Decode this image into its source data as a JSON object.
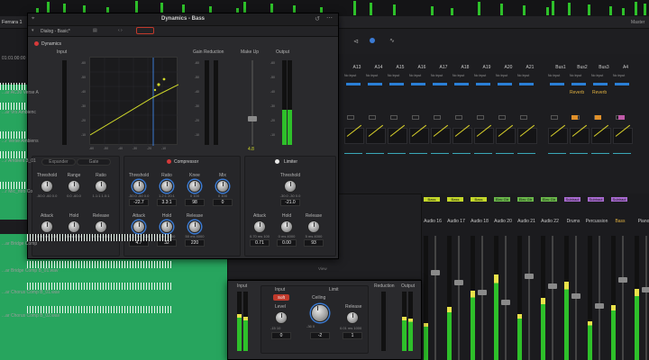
{
  "background": {
    "timeline_title": "Ferrara 1",
    "timecode": "01:01:00:00",
    "track_labels": [
      "...ar AC30 Verse A",
      "...ar Vrs Ambienc",
      "...r Verse Ambiens",
      "...r Ambient 3_01",
      "...r Mic_ntro Co",
      "...ar Bridge Comp",
      "...ar Bridge Comp B_01.wav",
      "...ar Chorus Comp B_01.wav",
      "...ar Chorus Comp B_02.wav"
    ],
    "channels_top": [
      "A13",
      "A14",
      "A15",
      "A16",
      "A17",
      "A18",
      "A19",
      "A20",
      "A21",
      "Bus1",
      "Bus2",
      "Bus3",
      "A4"
    ],
    "no_input": "No Input",
    "reverb": "Reverb",
    "chips": [
      "Bass",
      "Bass",
      "Bass",
      "Elec Gtr",
      "Elec Gtr",
      "Elec Gtr",
      "Subtract",
      "Subtract",
      "Subtract"
    ],
    "channels_bottom": [
      "Audio 16",
      "Audio 17",
      "Audio 18",
      "Audio 20",
      "Audio 21",
      "Audio 22",
      "Drums",
      "Percussion",
      "Bass",
      "Piano"
    ],
    "bottom_label": "Bass",
    "mastering": "Master",
    "view_label": "View"
  },
  "dynamics": {
    "title": "Dynamics - Bass",
    "preset": "Dialog - Basic*",
    "section": "Dynamics",
    "labels": {
      "input": "Input",
      "gain_reduction": "Gain Reduction",
      "makeup": "Make Up",
      "output": "Output"
    },
    "makeup_value": "4.8",
    "graph_ticks": [
      "-60",
      "-50",
      "-40",
      "-30",
      "-20",
      "-10"
    ],
    "expander": {
      "title": "Expander",
      "gate": "Gate",
      "knobs": [
        {
          "label": "Threshold",
          "range": "-50.0  -60   0.0",
          "value": ""
        },
        {
          "label": "Range",
          "range": "0.0   -60.0",
          "value": ""
        },
        {
          "label": "Ratio",
          "range": "1.1:1   1.0:1",
          "value": ""
        }
      ],
      "knobs2": [
        {
          "label": "Attack",
          "range": "0.00  ms  100",
          "value": ""
        },
        {
          "label": "Hold",
          "range": "0  ms  4000",
          "value": ""
        },
        {
          "label": "Release",
          "range": "50  ms  4000",
          "value": ""
        }
      ]
    },
    "compressor": {
      "title": "Compressor",
      "knobs": [
        {
          "label": "Threshold",
          "range": "-50.0  -60   0.0",
          "value": "-22.7"
        },
        {
          "label": "Ratio",
          "range": "1.2:1   20:1",
          "value": "3.3:1"
        },
        {
          "label": "Knee",
          "range": "0   100",
          "value": "98"
        },
        {
          "label": "Mix",
          "range": "0   100",
          "value": "0"
        }
      ],
      "knobs2": [
        {
          "label": "Attack",
          "range": "0.10  ms  100",
          "value": "4.7"
        },
        {
          "label": "Hold",
          "range": "0  ms  4000",
          "value": "32"
        },
        {
          "label": "Release",
          "range": "50  ms  4000",
          "value": "220"
        }
      ]
    },
    "limiter": {
      "title": "Limiter",
      "knobs": [
        {
          "label": "Threshold",
          "range": "-30.0  -30   0.0",
          "value": "-21.0"
        }
      ],
      "knobs2": [
        {
          "label": "Attack",
          "range": "0.70  ms  100",
          "value": "0.71"
        },
        {
          "label": "Hold",
          "range": "0  ms  4000",
          "value": "0.00"
        },
        {
          "label": "Release",
          "range": "5  ms  4000",
          "value": "93"
        }
      ]
    }
  },
  "limiter_window": {
    "labels": {
      "input": "Input",
      "input_section": "Input",
      "limit_section": "Limit",
      "reduction": "Reduction",
      "output": "Output"
    },
    "soft": "Soft",
    "level": {
      "label": "Level",
      "range": "-15   10",
      "value": "0"
    },
    "ceiling": {
      "label": "Ceiling",
      "range": "-36   0",
      "value": "-2"
    },
    "release": {
      "label": "Release",
      "range": "0.01  ms  1000",
      "value": "1"
    }
  }
}
